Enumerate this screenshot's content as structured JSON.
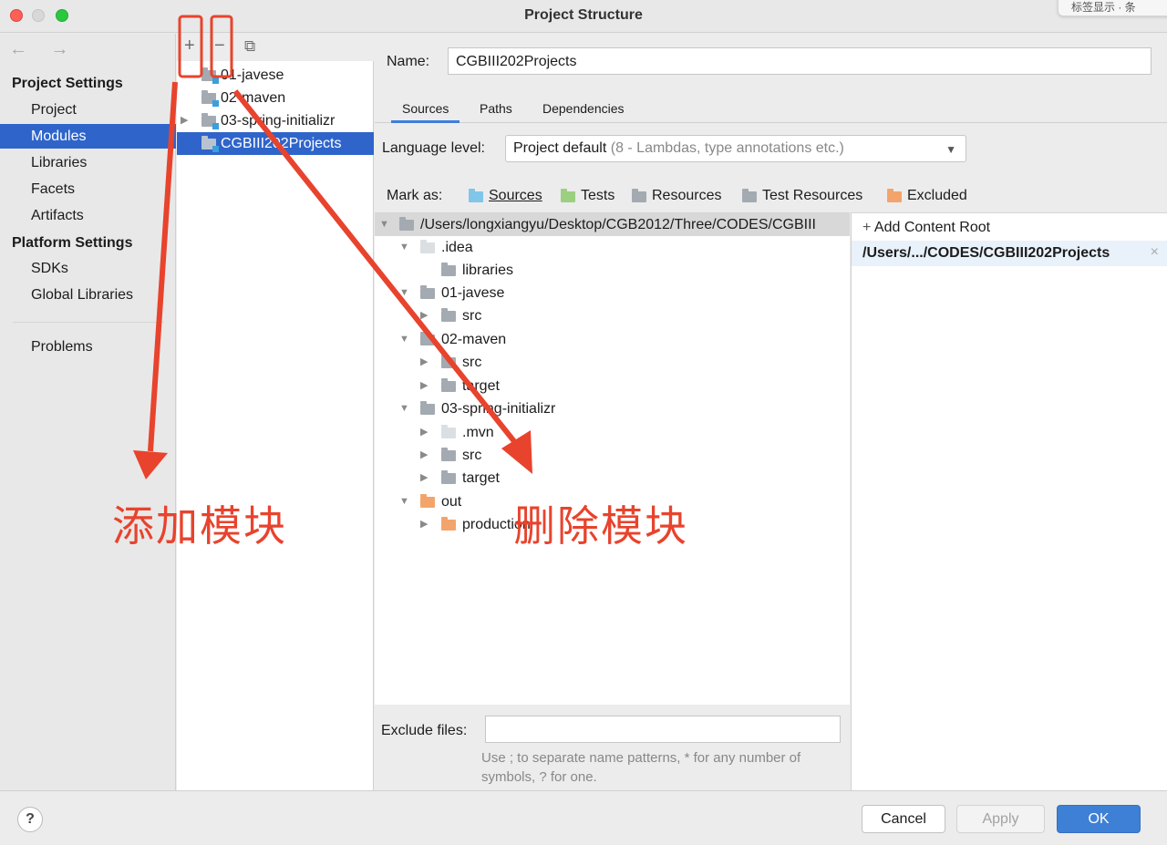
{
  "window": {
    "title": "Project Structure",
    "floating_tab_text": "标签显示 · 条"
  },
  "sidebar": {
    "nav_arrows": "← →",
    "project_settings_header": "Project Settings",
    "project_items": [
      {
        "label": "Project",
        "selected": false
      },
      {
        "label": "Modules",
        "selected": true
      },
      {
        "label": "Libraries",
        "selected": false
      },
      {
        "label": "Facets",
        "selected": false
      },
      {
        "label": "Artifacts",
        "selected": false
      }
    ],
    "platform_settings_header": "Platform Settings",
    "platform_items": [
      {
        "label": "SDKs"
      },
      {
        "label": "Global Libraries"
      }
    ],
    "problems_label": "Problems"
  },
  "modules_panel": {
    "toolbar": {
      "add": "+",
      "remove": "−",
      "copy": "⧉"
    },
    "items": [
      {
        "label": "01-javese",
        "expandable": false,
        "selected": false
      },
      {
        "label": "02-maven",
        "expandable": false,
        "selected": false
      },
      {
        "label": "03-spring-initializr",
        "expandable": true,
        "selected": false
      },
      {
        "label": "CGBIII202Projects",
        "expandable": false,
        "selected": true
      }
    ]
  },
  "main": {
    "name_label": "Name:",
    "name_value": "CGBIII202Projects",
    "tabs": [
      {
        "label": "Sources",
        "active": true
      },
      {
        "label": "Paths",
        "active": false
      },
      {
        "label": "Dependencies",
        "active": false
      }
    ],
    "language_level_label": "Language level:",
    "language_level_value": "Project default",
    "language_level_hint": "(8 - Lambdas, type annotations etc.)",
    "mark_as_label": "Mark as:",
    "mark_as": [
      {
        "label": "Sources",
        "color": "#7fc6e8"
      },
      {
        "label": "Tests",
        "color": "#9ccf7f"
      },
      {
        "label": "Resources",
        "color": "#a3aab1"
      },
      {
        "label": "Test Resources",
        "color": "#a3aab1"
      },
      {
        "label": "Excluded",
        "color": "#f3a46c"
      }
    ],
    "tree": [
      {
        "label": "/Users/longxiangyu/Desktop/CGB2012/Three/CODES/CGBIII",
        "depth": 0,
        "arrow": "down",
        "folder": "gray"
      },
      {
        "label": ".idea",
        "depth": 1,
        "arrow": "down",
        "folder": "light"
      },
      {
        "label": "libraries",
        "depth": 2,
        "arrow": "none",
        "folder": "gray"
      },
      {
        "label": "01-javese",
        "depth": 1,
        "arrow": "down",
        "folder": "gray"
      },
      {
        "label": "src",
        "depth": 2,
        "arrow": "right",
        "folder": "gray"
      },
      {
        "label": "02-maven",
        "depth": 1,
        "arrow": "down",
        "folder": "gray"
      },
      {
        "label": "src",
        "depth": 2,
        "arrow": "right",
        "folder": "gray"
      },
      {
        "label": "target",
        "depth": 2,
        "arrow": "right",
        "folder": "gray"
      },
      {
        "label": "03-spring-initializr",
        "depth": 1,
        "arrow": "down",
        "folder": "gray"
      },
      {
        "label": ".mvn",
        "depth": 2,
        "arrow": "right",
        "folder": "light"
      },
      {
        "label": "src",
        "depth": 2,
        "arrow": "right",
        "folder": "gray"
      },
      {
        "label": "target",
        "depth": 2,
        "arrow": "right",
        "folder": "gray"
      },
      {
        "label": "out",
        "depth": 1,
        "arrow": "down",
        "folder": "orange"
      },
      {
        "label": "production",
        "depth": 2,
        "arrow": "right",
        "folder": "orange"
      }
    ],
    "add_content_root": "Add Content Root",
    "content_root_path": "/Users/.../CODES/CGBIII202Projects",
    "exclude_files_label": "Exclude files:",
    "exclude_files_value": "",
    "exclude_hint": "Use ; to separate name patterns, * for any number of symbols, ? for one."
  },
  "footer": {
    "help": "?",
    "cancel": "Cancel",
    "apply": "Apply",
    "ok": "OK"
  },
  "annotations": {
    "add_module": "添加模块",
    "delete_module": "删除模块",
    "color": "#e8432d"
  }
}
